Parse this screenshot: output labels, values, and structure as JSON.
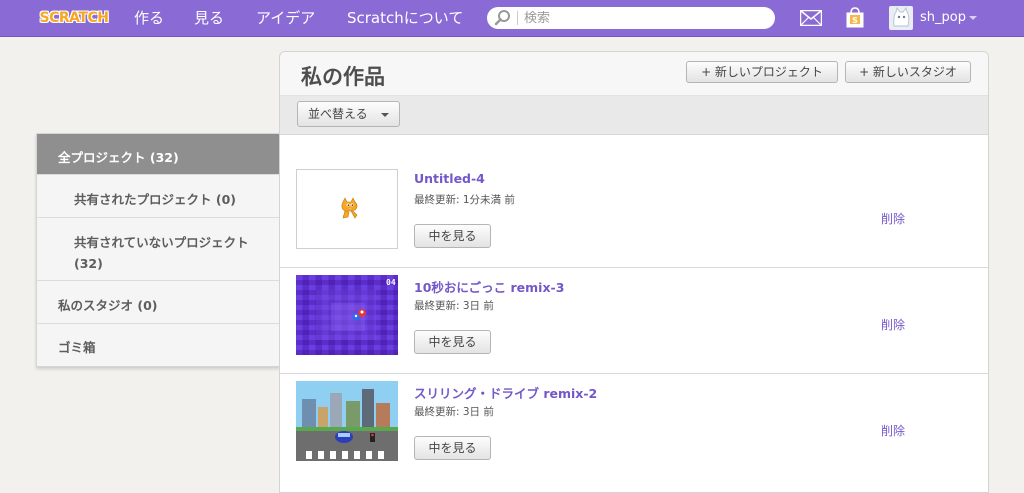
{
  "topbar": {
    "logo_text": "SCRATCH",
    "nav": [
      "作る",
      "見る",
      "アイデア",
      "Scratchについて"
    ],
    "search": {
      "placeholder": "検索",
      "value": ""
    },
    "username": "sh_pop",
    "accent_color": "#8a6bd6"
  },
  "sidebar": {
    "items": [
      {
        "label": "全プロジェクト (32)",
        "active": true
      },
      {
        "label": "共有されたプロジェクト (0)",
        "active": false
      },
      {
        "label": "共有されていないプロジェクト (32)",
        "active": false
      },
      {
        "label": "私のスタジオ (0)",
        "active": false
      },
      {
        "label": "ゴミ箱",
        "active": false
      }
    ]
  },
  "main": {
    "title": "私の作品",
    "new_project_label": "+ 新しいプロジェクト",
    "new_studio_label": "+ 新しいスタジオ",
    "sort_label": "並べ替える",
    "projects": [
      {
        "title": "Untitled-4",
        "meta": "最終更新: 1分未満 前",
        "view_label": "中を見る",
        "delete_label": "削除",
        "thumbnail": "scratch-cat"
      },
      {
        "title": "10秒おにごっこ remix-3",
        "meta": "最終更新: 3日 前",
        "view_label": "中を見る",
        "delete_label": "削除",
        "thumbnail": "purple-grid-game"
      },
      {
        "title": "スリリング・ドライブ remix-2",
        "meta": "最終更新: 3日 前",
        "view_label": "中を見る",
        "delete_label": "削除",
        "thumbnail": "city-road-game"
      }
    ]
  }
}
